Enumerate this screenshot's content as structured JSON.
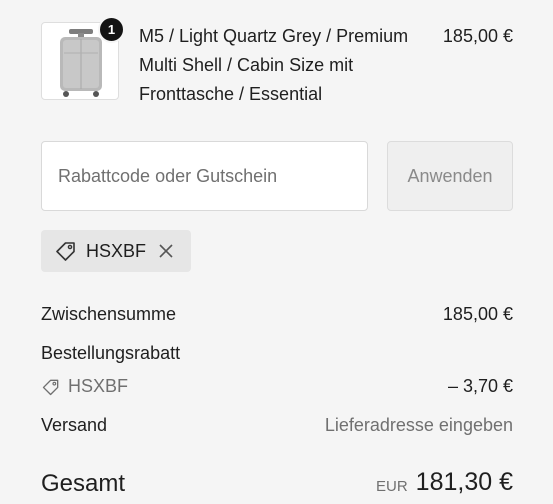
{
  "cart": {
    "item": {
      "quantity": "1",
      "name": "M5 / Light Quartz Grey / Premium Multi Shell / Cabin Size mit Fronttasche / Essential",
      "price": "185,00 €",
      "image": "grey-cabin-suitcase-thumbnail"
    }
  },
  "discount": {
    "placeholder": "Rabattcode oder Gutschein",
    "value": "",
    "apply_label": "Anwenden",
    "applied_code": "HSXBF"
  },
  "summary": {
    "subtotal_label": "Zwischensumme",
    "subtotal_value": "185,00 €",
    "order_discount_label": "Bestellungsrabatt",
    "order_discount_code": "HSXBF",
    "order_discount_value": "– 3,70 €",
    "shipping_label": "Versand",
    "shipping_value": "Lieferadresse eingeben",
    "total_label": "Gesamt",
    "total_currency": "EUR",
    "total_value": "181,30 €"
  },
  "colors": {
    "background": "#f5f5f5",
    "text": "#1f1f1f",
    "muted": "#707070",
    "chip": "#e6e6e6",
    "badge": "#141414"
  },
  "icons": [
    "tag-icon",
    "close-icon"
  ]
}
